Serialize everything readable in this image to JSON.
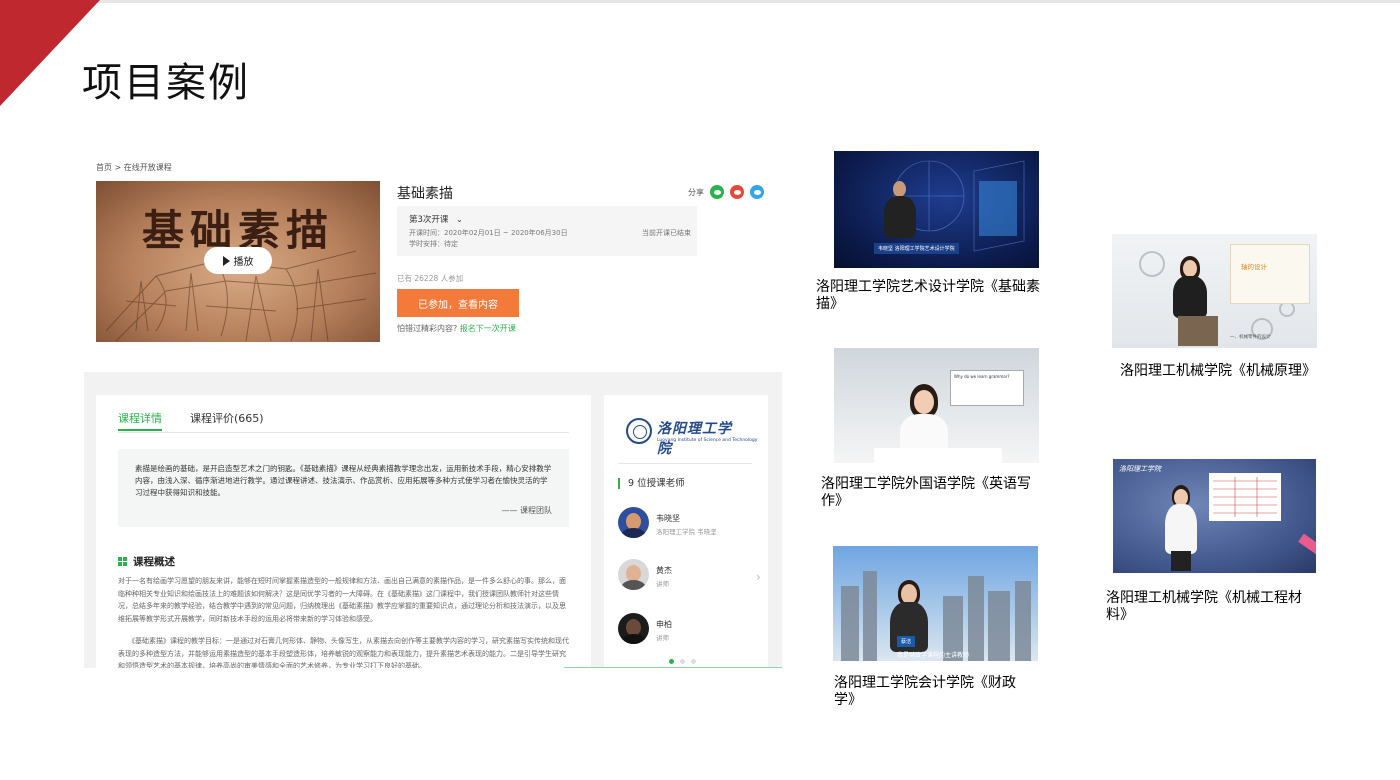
{
  "slide": {
    "title": "项目案例"
  },
  "course_page": {
    "breadcrumb": "首页 > 在线开放课程",
    "hero": {
      "title": "基础素描",
      "play_label": "播放"
    },
    "course_name": "基础素描",
    "share_label": "分享",
    "share_icons": [
      "wechat-icon",
      "weibo-icon",
      "qq-icon"
    ],
    "session": {
      "selector": "第3次开课",
      "time": "开课时间：2020年02月01日 ~ 2020年06月30日",
      "schedule": "学时安排：待定",
      "status": "当前开课已结束"
    },
    "joined": "已有 26228 人参加",
    "cta": "已参加，查看内容",
    "missed_prefix": "怕错过精彩内容?",
    "missed_link": "报名下一次开课",
    "tabs": [
      "课程详情",
      "课程评价(665)"
    ],
    "quote": {
      "text": "素描是绘画的基础，是开启造型艺术之门的钥匙。《基础素描》课程从经典素描教学理念出发，运用新技术手段，精心安排教学内容，由浅入深、循序渐进地进行教学。通过课程讲述、技法演示、作品赏析、应用拓展等多种方式使学习者在愉快灵活的学习过程中获得知识和技能。",
      "sign": "—— 课程团队"
    },
    "overview": {
      "heading": "课程概述",
      "p1": "对于一名有绘画学习愿望的朋友来讲，能够在短时间掌握素描造型的一般规律和方法、画出自己满意的素描作品，是一件多么舒心的事。那么，面临种种相关专业知识和绘画技法上的难题该如何解决？这是同优学习者的一大障碍。在《基础素描》这门课程中，我们授课团队教师针对这些情况，总结多年来的教学经验，结合教学中遇到的常见问题，归纳梳理出《基础素描》教学应掌握的重要知识点，通过理论分析和技法演示，以及思维拓展等教学形式开展教学，同时新技术手段的运用必将带来新的学习体验和感受。",
      "p2": "《基础素描》课程的教学目标：一是通过对石膏几何形体、静物、头像写生，从素描去向创作等主要教学内容的学习，研究素描写实传统和现代表现的多种造型方法，并能够运用素描造型的基本手段塑造形体，培养敏锐的观察能力和表现能力，提升素描艺术表现的能力。二是引导学生研究和领悟造型艺术的基本规律，培养高尚的审美情感和全面的艺术修养，为专业学习打下良好的基础。"
    },
    "school": {
      "name_cn": "洛阳理工学院",
      "name_en": "Luoyang Institute of Science and Technology"
    },
    "teachers_heading": "9 位授课老师",
    "teachers": [
      {
        "name": "韦晓坚",
        "sub": "洛阳理工学院 韦晓坚"
      },
      {
        "name": "黄杰",
        "sub": "讲师"
      },
      {
        "name": "申柏",
        "sub": "讲师"
      }
    ]
  },
  "thumbnails": [
    {
      "caption_l1": "洛阳理工学院艺术设计学院《基础素",
      "caption_l2": "描》",
      "lower_third": "洛阳理工学院艺术设计学院",
      "name_tag": "韦晓坚"
    },
    {
      "caption_l1": "洛阳理工学院外国语学院《英语写",
      "caption_l2": "作》",
      "slide_text": "Why do we learn grammar?"
    },
    {
      "caption_l1": "洛阳理工学院会计学院《财政",
      "caption_l2": "学》",
      "name_tag": "蔡洁",
      "subtitle": "我是财政学课程的主讲教师"
    },
    {
      "caption": "洛阳理工机械学院《机械原理》",
      "board_title": "轴的设计",
      "board_sub": "一、机械零件的设计"
    },
    {
      "caption_l1": "洛阳理工机械学院《机械工程材",
      "caption_l2": "料》",
      "logo_text": "洛阳理工学院"
    }
  ],
  "colors": {
    "accent_red": "#c0282f",
    "green": "#2bb24c",
    "orange": "#f47a39"
  }
}
